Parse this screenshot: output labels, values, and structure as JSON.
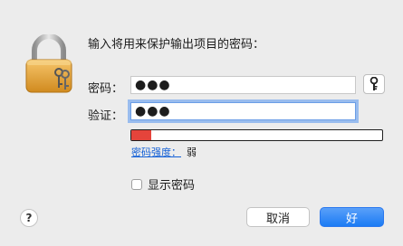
{
  "dialog": {
    "prompt": "输入将用来保护输出项目的密码：",
    "password_label": "密码：",
    "password_value": "●●●",
    "verify_label": "验证：",
    "verify_value": "●●●",
    "strength_link": "密码强度：",
    "strength_value": "弱",
    "strength_level": 0.08,
    "show_password_label": "显示密码",
    "show_password_checked": false,
    "help_label": "?",
    "cancel_label": "取消",
    "ok_label": "好"
  },
  "icons": {
    "lock": "padlock-with-keys-icon",
    "key": "key-icon"
  },
  "colors": {
    "accent": "#1b7bf4",
    "strength_weak": "#e5443b",
    "link": "#1460d6",
    "background": "#ececec"
  }
}
